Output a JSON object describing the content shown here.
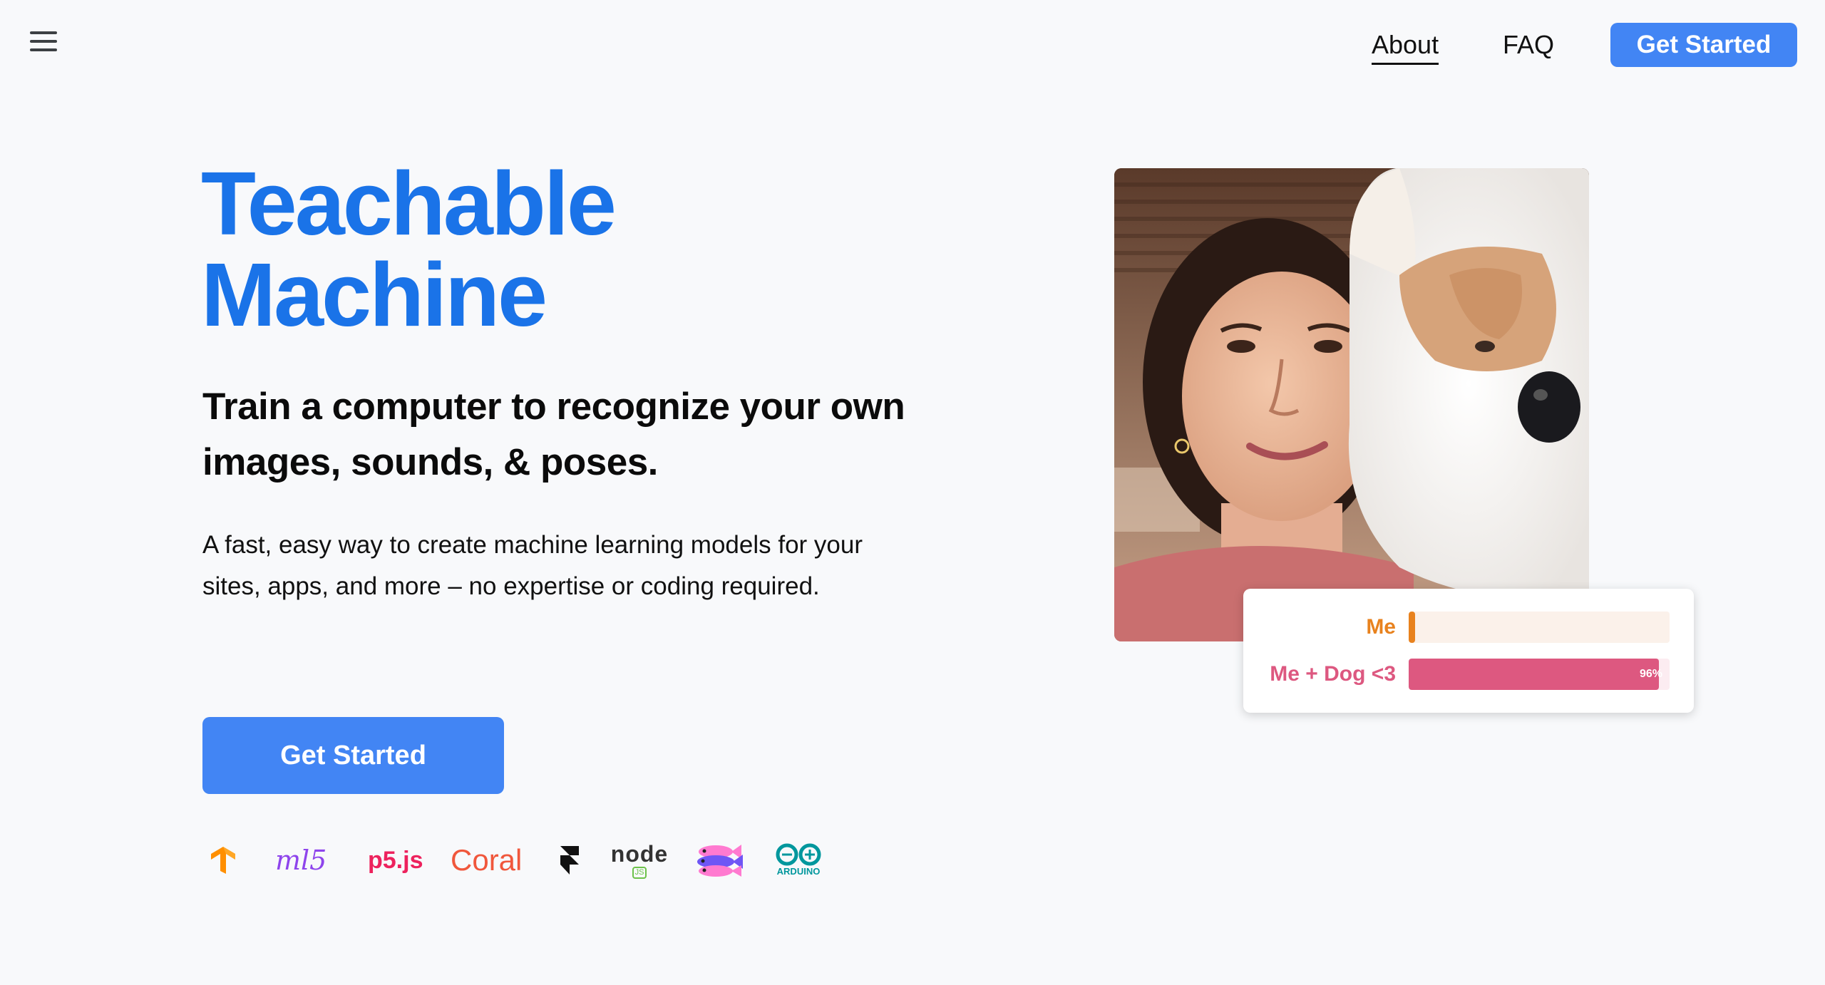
{
  "header": {
    "menu_icon": "hamburger-menu-icon",
    "nav": [
      {
        "label": "About",
        "active": true
      },
      {
        "label": "FAQ",
        "active": false
      }
    ],
    "cta_label": "Get Started"
  },
  "hero": {
    "title_line1": "Teachable",
    "title_line2": "Machine",
    "subtitle": "Train a computer to recognize your own images, sounds, & poses.",
    "description": "A fast, easy way to create machine learning models for your sites, apps, and more – no expertise or coding required.",
    "cta_label": "Get Started"
  },
  "partners": [
    {
      "name": "tensorflow",
      "icon": "tensorflow-logo-icon"
    },
    {
      "name": "ml5",
      "text": "ml5",
      "icon": "ml5-logo-icon"
    },
    {
      "name": "p5js",
      "text": "p5.js",
      "icon": "p5js-logo-icon"
    },
    {
      "name": "coral",
      "text": "Coral",
      "icon": "coral-logo-icon"
    },
    {
      "name": "framer",
      "icon": "framer-logo-icon"
    },
    {
      "name": "nodejs",
      "text": "node",
      "subtext": "JS",
      "icon": "nodejs-logo-icon"
    },
    {
      "name": "glitch",
      "icon": "glitch-fish-logo-icon"
    },
    {
      "name": "arduino",
      "text": "ARDUINO",
      "icon": "arduino-logo-icon"
    }
  ],
  "preview": {
    "predictions": [
      {
        "label": "Me",
        "value": 0.02,
        "color": "#e8821e",
        "track_color": "#fbf1ea",
        "percent_text": ""
      },
      {
        "label": "Me + Dog <3",
        "value": 0.96,
        "color": "#dd5880",
        "track_color": "#fcecf1",
        "percent_text": "96%"
      }
    ]
  },
  "colors": {
    "brand_blue": "#1a73e8",
    "button_blue": "#4285f4",
    "background": "#f8f9fb"
  }
}
